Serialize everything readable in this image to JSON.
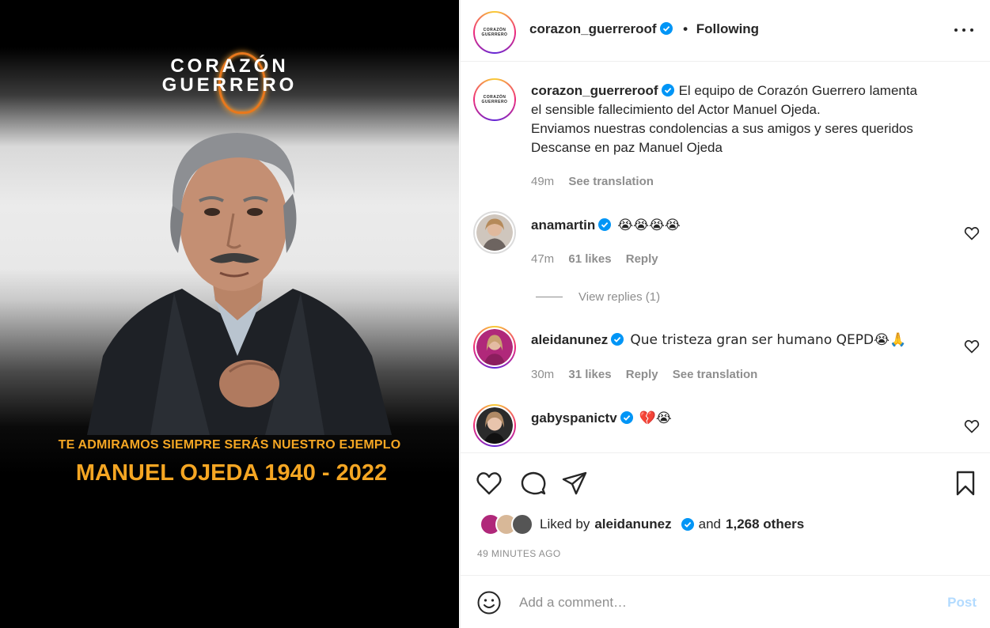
{
  "media": {
    "logo_line1": "CORAZÓN",
    "logo_line2": "GUERRERO",
    "tagline": "TE ADMIRAMOS SIEMPRE SERÁS NUESTRO EJEMPLO",
    "name_years": "MANUEL OJEDA 1940 - 2022",
    "accent_color": "#f5a623"
  },
  "header": {
    "avatar_text": "CORAZÓN GUERRERO",
    "username": "corazon_guerreroof",
    "separator": "•",
    "following_label": "Following",
    "more_icon": "more-horizontal-icon"
  },
  "caption": {
    "username": "corazon_guerreroof",
    "text_line1": "El equipo de Corazón Guerrero lamenta",
    "text_line2": "el sensible fallecimiento del Actor Manuel Ojeda.",
    "text_line3": "Enviamos nuestras condolencias a sus amigos y seres queridos",
    "text_line4": "Descanse en paz Manuel Ojeda",
    "time": "49m",
    "see_translation": "See translation"
  },
  "comments": [
    {
      "username": "anamartin",
      "text": "😭😭😭😭",
      "time": "47m",
      "likes": "61 likes",
      "reply": "Reply",
      "view_replies": "View replies (1)"
    },
    {
      "username": "aleidanunez",
      "text": "Que tristeza gran ser humano QEPD😭🙏",
      "time": "30m",
      "likes": "31 likes",
      "reply": "Reply",
      "see_translation": "See translation"
    },
    {
      "username": "gabyspanictv",
      "text": "💔😭"
    }
  ],
  "actions": {
    "liked_by_prefix": "Liked by",
    "liked_by_user": "aleidanunez",
    "and_label": "and",
    "others": "1,268 others",
    "timestamp": "49 MINUTES AGO"
  },
  "comment_bar": {
    "placeholder": "Add a comment…",
    "post_label": "Post"
  },
  "colors": {
    "verified_blue": "#0095f6",
    "post_disabled": "#b3dbff",
    "muted_text": "#8e8e8e"
  }
}
